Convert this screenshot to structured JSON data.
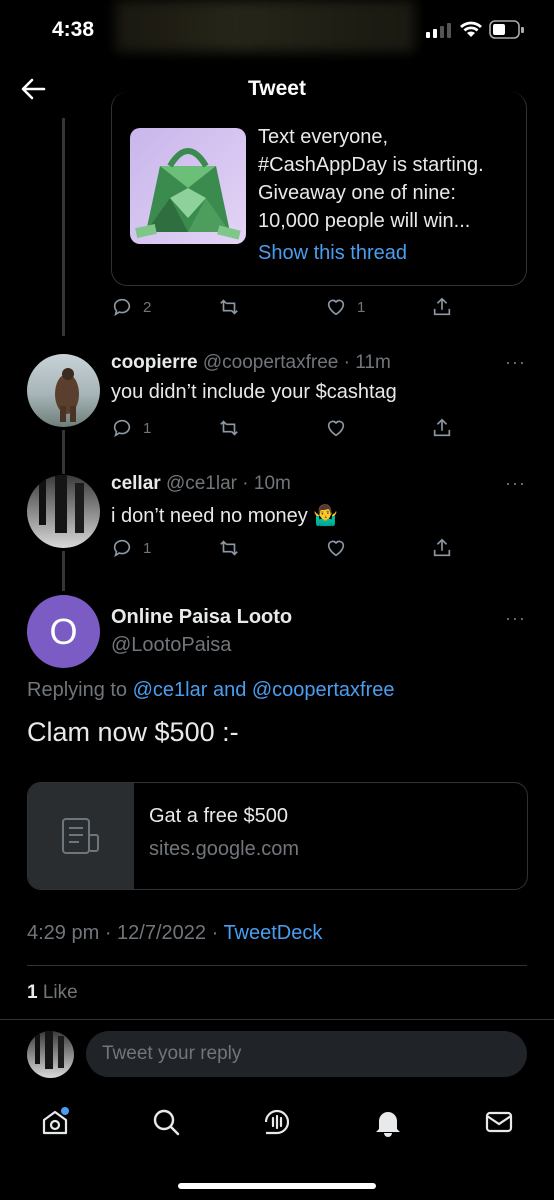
{
  "status_bar": {
    "time": "4:38"
  },
  "header": {
    "title": "Tweet"
  },
  "quoted_tweet": {
    "text_lines": [
      "Text everyone,",
      "#CashAppDay is starting.",
      "Giveaway one of nine:",
      "10,000 people will win..."
    ],
    "show_thread": "Show this thread",
    "replies": "2",
    "likes": "1"
  },
  "replies": [
    {
      "name": "coopierre",
      "handle": "@coopertaxfree",
      "time": "11m",
      "text": "you didn’t include your $cashtag",
      "reply_count": "1"
    },
    {
      "name": "cellar",
      "handle": "@ce1lar",
      "time": "10m",
      "text": "i don’t need no money 🤷‍♂️",
      "reply_count": "1"
    }
  ],
  "main_tweet": {
    "avatar_letter": "O",
    "name": "Online Paisa Looto",
    "handle": "@LootoPaisa",
    "replying_prefix": "Replying to",
    "replying_to": "@ce1lar and @coopertaxfree",
    "text": "Clam now $500 :-",
    "card_title": "Gat a free $500",
    "card_domain": "sites.google.com",
    "timestamp": "4:29 pm · 12/7/2022 ·",
    "source": "TweetDeck",
    "likes_count": "1",
    "likes_label": "Like"
  },
  "reply_box": {
    "placeholder": "Tweet your reply"
  },
  "colors": {
    "accent": "#4a9ef0",
    "background": "#000000",
    "muted": "#71767b",
    "avatar_purple": "#7b5cc4"
  },
  "icons": [
    "back-arrow-icon",
    "reply-icon",
    "retweet-icon",
    "like-icon",
    "share-icon",
    "more-icon",
    "home-icon",
    "search-icon",
    "spaces-icon",
    "notifications-icon",
    "messages-icon"
  ]
}
